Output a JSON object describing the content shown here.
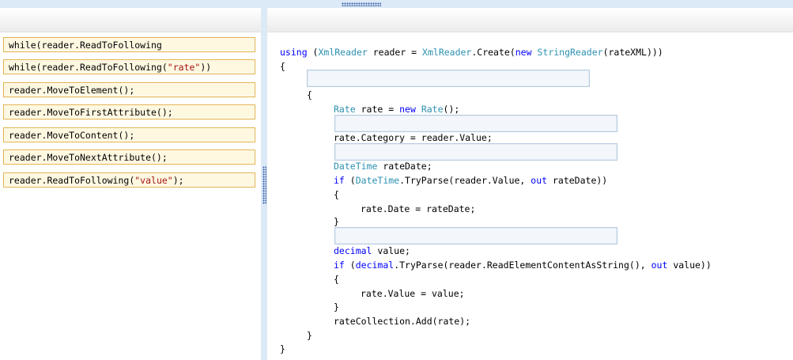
{
  "options": [
    {
      "pre": "while(reader.ReadToFollowing",
      "str": "",
      "post": ""
    },
    {
      "pre": "while(reader.ReadToFollowing(",
      "str": "\"rate\"",
      "post": "))"
    },
    {
      "pre": "reader.MoveToElement();",
      "str": "",
      "post": ""
    },
    {
      "pre": "reader.MoveToFirstAttribute();",
      "str": "",
      "post": ""
    },
    {
      "pre": "reader.MoveToContent();",
      "str": "",
      "post": ""
    },
    {
      "pre": "reader.MoveToNextAttribute();",
      "str": "",
      "post": ""
    },
    {
      "pre": "reader.ReadToFollowing(",
      "str": "\"value\"",
      "post": ");"
    }
  ],
  "code": {
    "l1": {
      "kw_using": "using",
      "p1": " (",
      "ty1": "XmlReader",
      "p2": " reader = ",
      "ty2": "XmlReader",
      "p3": ".Create(",
      "kw_new": "new",
      "p4": " ",
      "ty3": "StringReader",
      "p5": "(rateXML)))"
    },
    "l2": "{",
    "l3": "{",
    "l4": {
      "ty1": "Rate",
      "p1": " rate = ",
      "kw_new": "new",
      "p2": " ",
      "ty2": "Rate",
      "p3": "();"
    },
    "l5": "rate.Category = reader.Value;",
    "l6": {
      "ty1": "DateTime",
      "p1": " rateDate;"
    },
    "l7": {
      "kw_if": "if",
      "p1": " (",
      "ty1": "DateTime",
      "p2": ".TryParse(reader.Value, ",
      "kw_out": "out",
      "p3": " rateDate))"
    },
    "l8": "{",
    "l9": "rate.Date = rateDate;",
    "l10": "}",
    "l11": {
      "kw_decimal": "decimal",
      "p1": " value;"
    },
    "l12": {
      "kw_if": "if",
      "p1": " (",
      "kw_decimal": "decimal",
      "p2": ".TryParse(reader.ReadElementContentAsString(), ",
      "kw_out": "out",
      "p3": " value))"
    },
    "l13": "{",
    "l14": "rate.Value = value;",
    "l15": "}",
    "l16": "rateCollection.Add(rate);",
    "l17": "}",
    "l18": "}"
  }
}
